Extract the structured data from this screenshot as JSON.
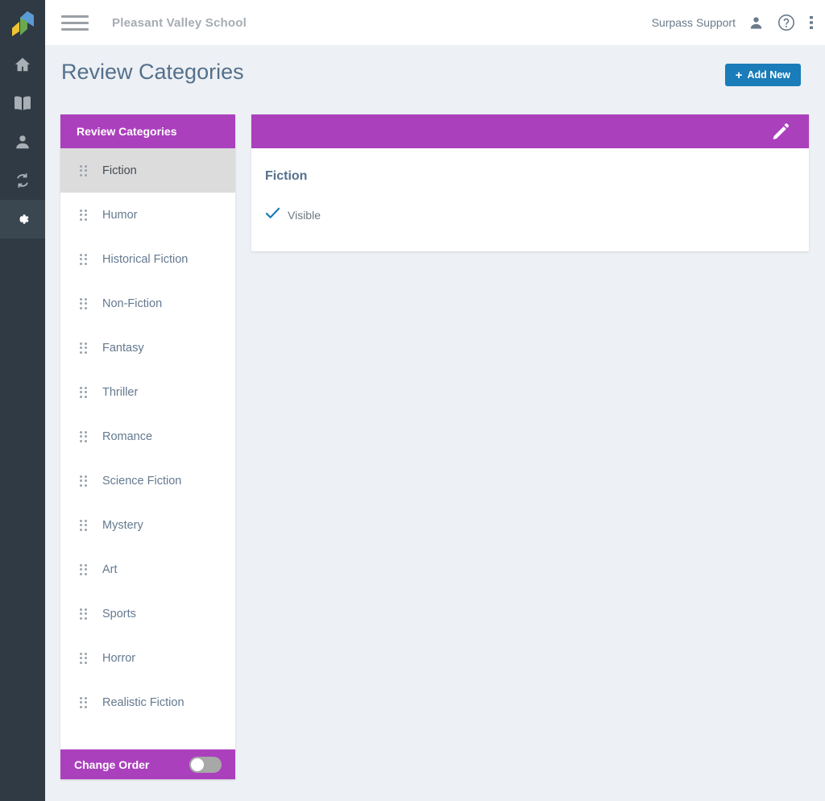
{
  "left_rail": {
    "logo": "surpass-logo",
    "items": [
      {
        "icon": "home-icon",
        "name": "home",
        "active": false
      },
      {
        "icon": "book-icon",
        "name": "library",
        "active": false
      },
      {
        "icon": "person-icon",
        "name": "people",
        "active": false
      },
      {
        "icon": "sync-icon",
        "name": "sync",
        "active": false
      },
      {
        "icon": "gear-icon",
        "name": "settings",
        "active": true
      }
    ]
  },
  "topbar": {
    "menu_icon": "hamburger-icon",
    "school_name": "Pleasant Valley School",
    "support_label": "Surpass Support",
    "account_icon": "person-icon",
    "help_icon": "help-circle-icon",
    "more_icon": "more-vertical-icon"
  },
  "page": {
    "title": "Review Categories",
    "add_new_label": "Add New",
    "add_new_plus": "+"
  },
  "list_panel": {
    "header_title": "Review Categories",
    "items": [
      {
        "label": "Fiction",
        "selected": true
      },
      {
        "label": "Humor",
        "selected": false
      },
      {
        "label": "Historical Fiction",
        "selected": false
      },
      {
        "label": "Non-Fiction",
        "selected": false
      },
      {
        "label": "Fantasy",
        "selected": false
      },
      {
        "label": "Thriller",
        "selected": false
      },
      {
        "label": "Romance",
        "selected": false
      },
      {
        "label": "Science Fiction",
        "selected": false
      },
      {
        "label": "Mystery",
        "selected": false
      },
      {
        "label": "Art",
        "selected": false
      },
      {
        "label": "Sports",
        "selected": false
      },
      {
        "label": "Horror",
        "selected": false
      },
      {
        "label": "Realistic Fiction",
        "selected": false
      }
    ],
    "change_order_label": "Change Order",
    "change_order_enabled": false
  },
  "detail": {
    "edit_icon": "pencil-icon",
    "title": "Fiction",
    "visible_label": "Visible",
    "visible_checked": true,
    "check_icon": "check-icon"
  },
  "colors": {
    "purple": "#ab40bd",
    "blue": "#1a7cb8",
    "rail": "#2f3a45",
    "rail_active": "#3a4650",
    "page_bg": "#edf0f4",
    "title_text": "#54708c",
    "row_selected": "#dcdcdc"
  }
}
